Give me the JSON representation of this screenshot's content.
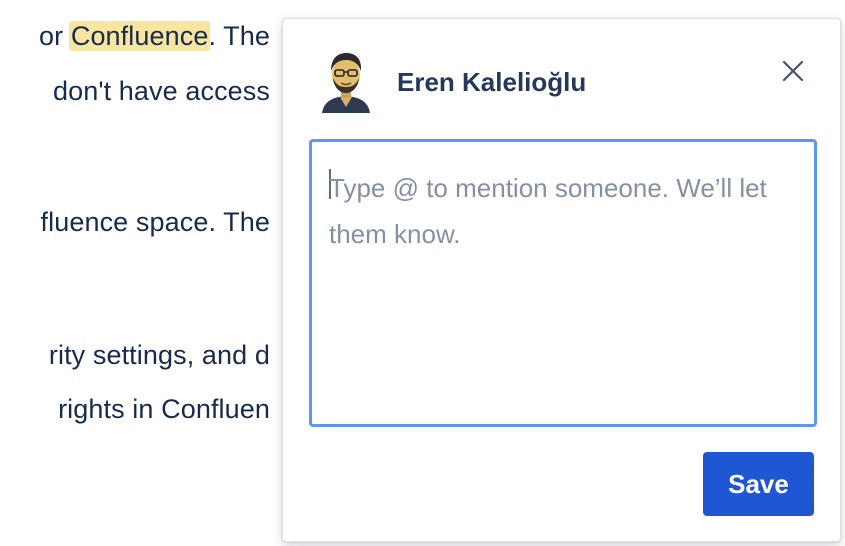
{
  "document": {
    "lines": [
      {
        "before": "or ",
        "highlight": "Confluence",
        "after": ". The"
      },
      {
        "text": "don't have access"
      },
      {
        "text": "fluence space. The"
      },
      {
        "text": "rity settings, and d"
      },
      {
        "text": "rights in Confluen"
      }
    ],
    "highlight_color": "#f8e6a0"
  },
  "comment_popup": {
    "author": "Eren Kalelioğlu",
    "avatar_icon": "user-avatar-icon",
    "close_icon": "close-icon",
    "editor": {
      "placeholder": "Type @ to mention someone. We’ll let them know.",
      "value": ""
    },
    "save_label": "Save",
    "colors": {
      "save_button": "#1f56d4",
      "editor_focus_border": "#5d97f0",
      "text": "#172b4d"
    }
  }
}
